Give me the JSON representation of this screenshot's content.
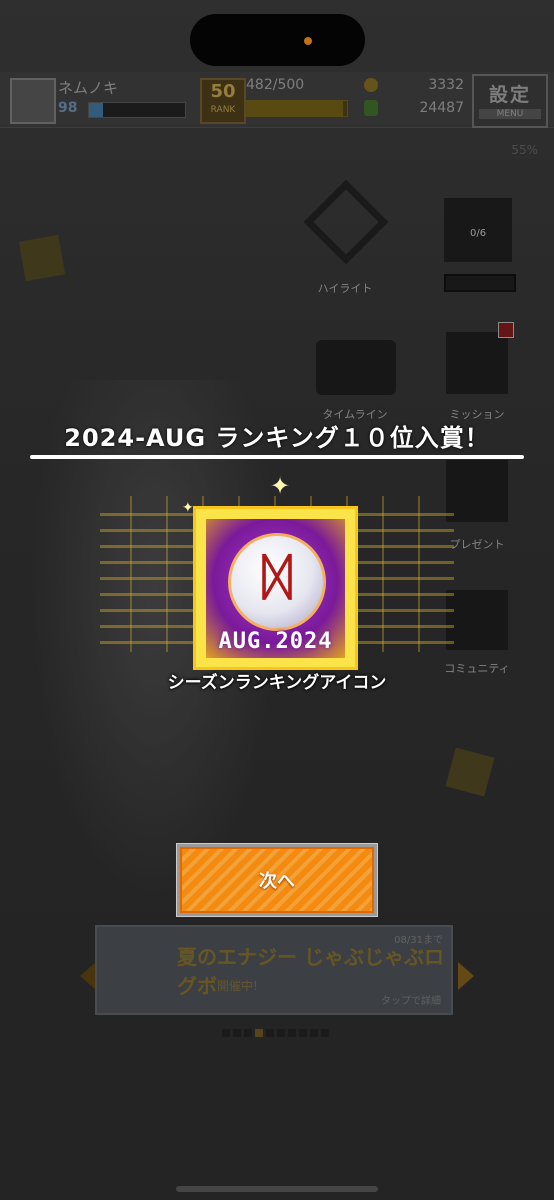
{
  "player": {
    "name": "ネムノキ",
    "level": "98",
    "level_progress": 0.15
  },
  "rank": {
    "value": "50",
    "label": "RANK"
  },
  "stamina": {
    "text": "482/500",
    "progress": 0.96
  },
  "currency": {
    "coins": "3332",
    "gems": "24487"
  },
  "settings": {
    "label": "設定",
    "sub": "MENU"
  },
  "battery": "55%",
  "menu": {
    "highlight": "ハイライト",
    "card_count": "0/6",
    "timeline": "タイムライン",
    "mission": "ミッション",
    "present": "プレゼント",
    "community": "コミュニティ"
  },
  "banner": {
    "title": "夏のエナジー  じゃぶじゃぶログボ",
    "subtitle": "開催中!",
    "date": "08/31まで",
    "tap": "タップで詳細"
  },
  "award": {
    "title": "2024-AUG ランキング１０位入賞！",
    "icon_date": "AUG.2024",
    "icon_glyph": "ᛞ",
    "icon_name": "シーズンランキングアイコン"
  },
  "next_button": "次へ",
  "colors": {
    "accent": "#f58a10",
    "frame": "#fbe34a"
  }
}
